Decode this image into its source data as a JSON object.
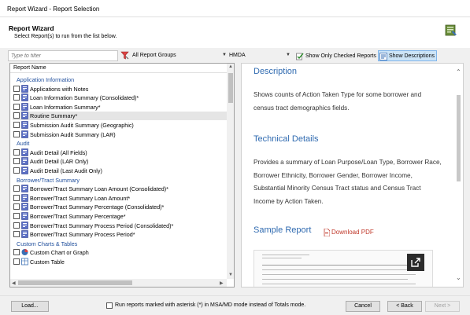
{
  "window": {
    "title": "Report Wizard - Report Selection"
  },
  "header": {
    "title": "Report Wizard",
    "subtitle": "Select Report(s) to run from the list below."
  },
  "toolbar": {
    "filter_placeholder": "Type to filter",
    "report_groups": "All Report Groups",
    "dataset": "HMDA",
    "show_checked_label": "Show Only Checked Reports",
    "show_descriptions_label": "Show Descriptions"
  },
  "list": {
    "column_header": "Report Name",
    "groups": [
      {
        "name": "Application Information",
        "items": [
          {
            "label": "Applications with Notes",
            "selected": false
          },
          {
            "label": "Loan Information Summary (Consolidated)*",
            "selected": false
          },
          {
            "label": "Loan Information Summary*",
            "selected": false
          },
          {
            "label": "Routine Summary*",
            "selected": true
          },
          {
            "label": "Submission Audit Summary (Geographic)",
            "selected": false
          },
          {
            "label": "Submission Audit Summary (LAR)",
            "selected": false
          }
        ]
      },
      {
        "name": "Audit",
        "items": [
          {
            "label": "Audit Detail (All Fields)",
            "selected": false
          },
          {
            "label": "Audit Detail (LAR Only)",
            "selected": false
          },
          {
            "label": "Audit Detail (Last Audit Only)",
            "selected": false
          }
        ]
      },
      {
        "name": "Borrower/Tract Summary",
        "items": [
          {
            "label": "Borrower/Tract Summary Loan Amount (Consolidated)*",
            "selected": false
          },
          {
            "label": "Borrower/Tract Summary Loan Amount*",
            "selected": false
          },
          {
            "label": "Borrower/Tract Summary Percentage (Consolidated)*",
            "selected": false
          },
          {
            "label": "Borrower/Tract Summary Percentage*",
            "selected": false
          },
          {
            "label": "Borrower/Tract Summary Process Period (Consolidated)*",
            "selected": false
          },
          {
            "label": "Borrower/Tract Summary Process Period*",
            "selected": false
          }
        ]
      },
      {
        "name": "Custom Charts & Tables",
        "items": [
          {
            "label": "Custom Chart or Graph",
            "selected": false
          },
          {
            "label": "Custom Table",
            "selected": false
          }
        ]
      }
    ]
  },
  "description_panel": {
    "description_heading": "Description",
    "description_text": "Shows counts of Action Taken Type for some borrower and census tract demographics fields.",
    "technical_heading": "Technical Details",
    "technical_text": "Provides a summary of Loan Purpose/Loan Type, Borrower Race, Borrower Ethnicity, Borrower Gender, Borrower Income, Substantial Minority Census Tract status and Census Tract Income by Action Taken.",
    "sample_heading": "Sample Report",
    "download_label": "Download PDF"
  },
  "footer": {
    "load_label": "Load...",
    "msa_option_label": "Run reports marked with asterisk (*) in MSA/MD mode instead of Totals mode.",
    "cancel_label": "Cancel",
    "back_label": "< Back",
    "next_label": "Next >"
  },
  "colors": {
    "accent_blue": "#2f6ab0",
    "group_blue": "#1f4e9c",
    "pdf_red": "#c0392b",
    "toggle_active": "#cce4f7"
  }
}
